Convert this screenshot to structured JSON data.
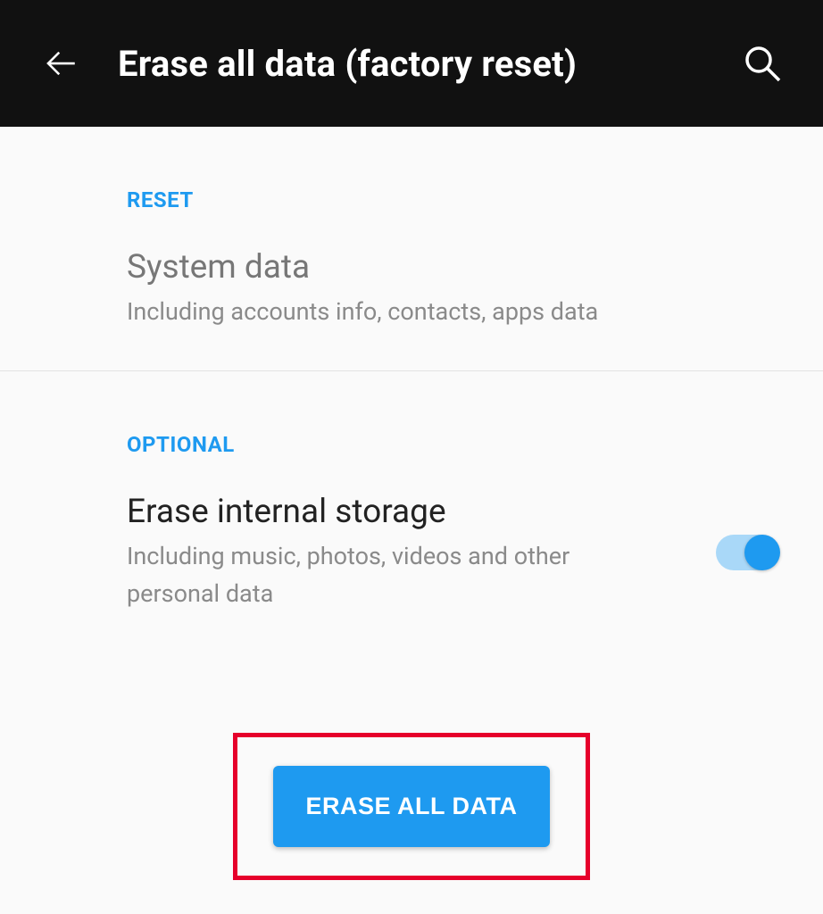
{
  "header": {
    "title": "Erase all data (factory reset)"
  },
  "sections": {
    "reset": {
      "label": "RESET",
      "item": {
        "title": "System data",
        "subtitle": "Including accounts info, contacts, apps data"
      }
    },
    "optional": {
      "label": "OPTIONAL",
      "item": {
        "title": "Erase internal storage",
        "subtitle": "Including music, photos, videos and other personal data",
        "toggle_on": true
      }
    }
  },
  "cta": {
    "label": "ERASE ALL DATA"
  },
  "colors": {
    "accent": "#1e9af0",
    "highlight_border": "#e6002b"
  }
}
